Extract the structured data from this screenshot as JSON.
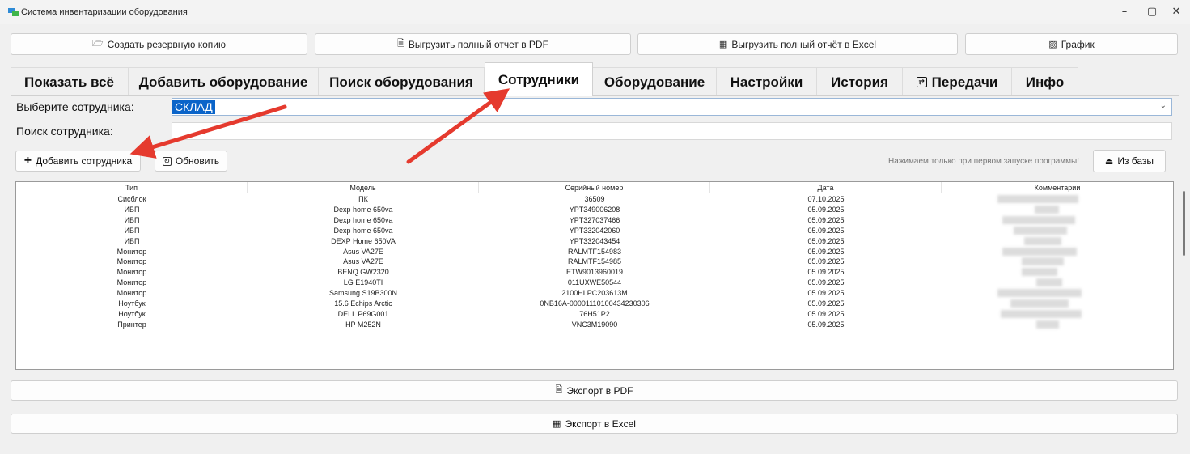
{
  "window": {
    "title": "Система инвентаризации оборудования",
    "min": "–",
    "max": "▢",
    "close": "✕"
  },
  "toolbar": {
    "backup": "Создать резервную копию",
    "pdf_full": "Выгрузить полный отчет в PDF",
    "excel_full": "Выгрузить полный отчёт в Excel",
    "chart": "График"
  },
  "tabs": [
    "Показать всё",
    "Добавить оборудование",
    "Поиск оборудования",
    "Сотрудники",
    "Оборудование",
    "Настройки",
    "История",
    "Передачи",
    "Инфо"
  ],
  "employees": {
    "select_label": "Выберите сотрудника:",
    "selected": "СКЛАД",
    "search_label": "Поиск сотрудника:",
    "search_value": "",
    "add_button": "Добавить сотрудника",
    "refresh_button": "Обновить",
    "hint": "Нажимаем только при первом запуске программы!",
    "from_db_button": "Из базы"
  },
  "table": {
    "columns": [
      "Тип",
      "Модель",
      "Серийный номер",
      "Дата",
      "Комментарии"
    ],
    "rows": [
      [
        "Сисблок",
        "ПК",
        "36509",
        "07.10.2025"
      ],
      [
        "ИБП",
        "Dexp home 650va",
        "YPT349006208",
        "05.09.2025"
      ],
      [
        "ИБП",
        "Dexp home 650va",
        "YPT327037466",
        "05.09.2025"
      ],
      [
        "ИБП",
        "Dexp home 650va",
        "YPT332042060",
        "05.09.2025"
      ],
      [
        "ИБП",
        "DEXP Home 650VA",
        "YPT332043454",
        "05.09.2025"
      ],
      [
        "Монитор",
        "Asus VA27E",
        "RALMTF154983",
        "05.09.2025"
      ],
      [
        "Монитор",
        "Asus VA27E",
        "RALMTF154985",
        "05.09.2025"
      ],
      [
        "Монитор",
        "BENQ GW2320",
        "ETW9013960019",
        "05.09.2025"
      ],
      [
        "Монитор",
        "LG E1940TI",
        "011UXWE50544",
        "05.09.2025"
      ],
      [
        "Монитор",
        "Samsung S19B300N",
        "2100HLPC203613M",
        "05.09.2025"
      ],
      [
        "Ноутбук",
        "15.6 Echips Arctic",
        "0NB16A-00001110100434230306",
        "05.09.2025"
      ],
      [
        "Ноутбук",
        "DELL P69G001",
        "76H51P2",
        "05.09.2025"
      ],
      [
        "Принтер",
        "HP M252N",
        "VNC3M19090",
        "05.09.2025"
      ]
    ]
  },
  "export": {
    "pdf": "Экспорт в PDF",
    "excel": "Экспорт в Excel"
  },
  "icons": {
    "backup": "folder-icon",
    "pdf": "document-icon",
    "excel": "spreadsheet-icon",
    "chart": "chart-icon",
    "transfers": "transfer-icon",
    "add": "plus-icon",
    "refresh": "refresh-icon",
    "from_db": "import-icon"
  },
  "colors": {
    "selection": "#0a64c9",
    "arrow": "#e53a2e"
  }
}
